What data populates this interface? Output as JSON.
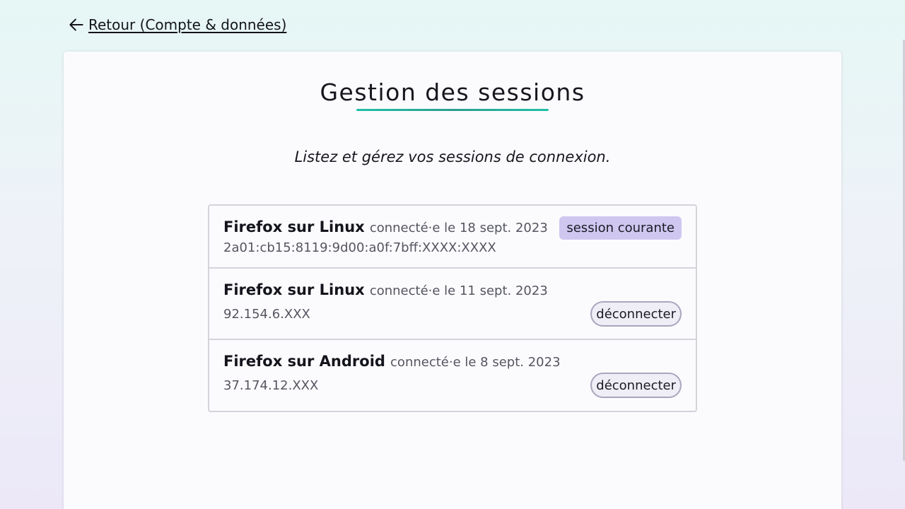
{
  "nav": {
    "back_label": " Retour (Compte & données)",
    "back_icon": "arrow-left-icon"
  },
  "page": {
    "title": "Gestion des sessions",
    "subtitle": "Listez et gérez vos sessions de connexion."
  },
  "colors": {
    "accent_underline": "#2a9e8e",
    "badge_background": "#cfc7f0",
    "button_border": "#a9a6bd"
  },
  "sessions": [
    {
      "browser": "Firefox sur Linux",
      "connected": "connecté·e le 18 sept. 2023",
      "ip": "2a01:cb15:8119:9d00:a0f:7bff:XXXX:XXXX",
      "badge": "session courante"
    },
    {
      "browser": "Firefox sur Linux",
      "connected": "connecté·e le 11 sept. 2023",
      "ip": "92.154.6.XXX",
      "action": "déconnecter"
    },
    {
      "browser": "Firefox sur Android",
      "connected": "connecté·e le 8 sept. 2023",
      "ip": "37.174.12.XXX",
      "action": "déconnecter"
    }
  ]
}
